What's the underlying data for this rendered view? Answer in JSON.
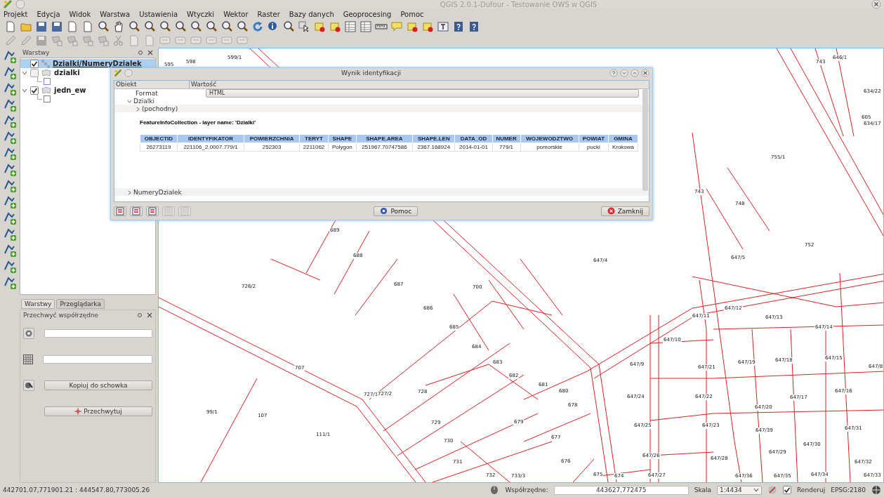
{
  "window": {
    "title": "QGIS 2.0.1-Dufour - Testowanie OWS w QGIS"
  },
  "menu": [
    "Projekt",
    "Edycja",
    "Widok",
    "Warstwa",
    "Ustawienia",
    "Wtyczki",
    "Wektor",
    "Raster",
    "Bazy danych",
    "Geoprocesing",
    "Pomoc"
  ],
  "layers_panel": {
    "title": "Warstwy",
    "layers": [
      {
        "name": "Dzialki/NumeryDzialek",
        "checked": true,
        "selected": true
      },
      {
        "name": "dzialki",
        "checked": false,
        "selected": false,
        "expanded": true,
        "children": [
          {
            "color": "#8080ff"
          }
        ]
      },
      {
        "name": "jedn_ew",
        "checked": true,
        "selected": false,
        "expanded": true,
        "children": [
          {
            "color": "#808080"
          }
        ]
      }
    ]
  },
  "dock_tabs": [
    {
      "label": "Warstwy",
      "selected": true
    },
    {
      "label": "Przeglądarka",
      "selected": false
    }
  ],
  "capture_panel": {
    "title": "Przechwyć współrzędne",
    "copy_button": "Kopiuj do schowka",
    "capture_button": "Przechwytuj"
  },
  "identify_dialog": {
    "title": "Wynik identyfikacji",
    "columns": [
      "Obiekt",
      "Wartość"
    ],
    "format_label": "Format",
    "format_value": "HTML",
    "layer": {
      "name": "Dzialki",
      "expanded": true
    },
    "sublayer": {
      "name": "(pochodny)",
      "expanded": false
    },
    "html_title": "FeatureInfoCollection - layer name: 'Dzialki'",
    "table": {
      "columns": [
        "OBJECTID",
        "IDENTYFIKATOR",
        "POWIERZCHNIA",
        "TERYT",
        "SHAPE",
        "SHAPE.AREA",
        "SHAPE.LEN",
        "DATA_OD",
        "NUMER",
        "WOJEWODZTWO",
        "POWIAT",
        "GMINA"
      ],
      "rows": [
        [
          "26273119",
          "221106_2.0007.779/1",
          "252303",
          "2211062",
          "Polygon",
          "251967.70747586",
          "2367.168924",
          "2014-01-01",
          "779/1",
          "pomorskie",
          "pucki",
          "Krokowa"
        ]
      ]
    },
    "layer2": {
      "name": "NumeryDzialek",
      "expanded": false
    },
    "tool_buttons": [
      {
        "disabled": false
      },
      {
        "disabled": false
      },
      {
        "disabled": false
      },
      {
        "disabled": true
      },
      {
        "disabled": true
      }
    ],
    "help_button": "Pomoc",
    "close_button": "Zamknij"
  },
  "map": {
    "parcels": [
      "598",
      "599/1",
      "595",
      "646/1",
      "743",
      "634/22",
      "605",
      "634/17",
      "755/1",
      "743",
      "748",
      "752",
      "689",
      "688",
      "647/4",
      "647/5",
      "726/2",
      "687",
      "700",
      "686",
      "647/12",
      "647/11",
      "647/13",
      "647/14",
      "685",
      "647/10",
      "684",
      "647/8",
      "683",
      "647/9",
      "647/21",
      "647/19",
      "647/18",
      "647/15",
      "707",
      "682",
      "681",
      "727/1",
      "727/2",
      "728",
      "680",
      "647/24",
      "647/22",
      "647/20",
      "647/17",
      "647/16",
      "99/1",
      "107",
      "678",
      "111/1",
      "729",
      "679",
      "647/25",
      "647/23",
      "647/39",
      "647/31",
      "677",
      "730",
      "647/30",
      "731",
      "676",
      "647/26",
      "647/28",
      "647/29",
      "647/32",
      "732",
      "733/3",
      "675",
      "674",
      "647/27",
      "647/36",
      "647/35",
      "647/34",
      "647/33"
    ]
  },
  "status_bar": {
    "extent": "442701.07,771901.21 : 444547.80,773005.26",
    "coords_label": "Współrzędne:",
    "coords_value": "443627,772475",
    "scale_label": "Skala",
    "scale_value": "1:4434",
    "render_label": "Renderuj",
    "render_checked": true,
    "crs": "EPSG:2180"
  }
}
